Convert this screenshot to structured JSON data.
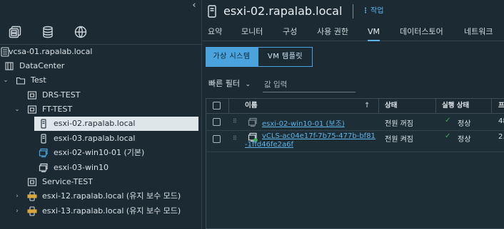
{
  "nav": {
    "collapse_icon": "chevron-left-icon",
    "icons": [
      "hosts-clusters-icon",
      "storage-icon",
      "network-icon"
    ],
    "tree": [
      {
        "label": "vcsa-01.rapalab.local",
        "icon": "vcenter-icon",
        "selected": false
      },
      {
        "label": "DataCenter",
        "icon": "datacenter-icon",
        "selected": false
      },
      {
        "label": "Test",
        "icon": "folder-icon",
        "selected": false
      },
      {
        "label": "DRS-TEST",
        "icon": "cluster-icon",
        "selected": false
      },
      {
        "label": "FT-TEST",
        "icon": "cluster-icon",
        "selected": false
      },
      {
        "label": "esxi-02.rapalab.local",
        "icon": "host-icon",
        "selected": true
      },
      {
        "label": "esxi-03.rapalab.local",
        "icon": "host-icon",
        "selected": false
      },
      {
        "label": "esxi-02-win10-01 (기본)",
        "icon": "vm-ft-primary-icon",
        "selected": false
      },
      {
        "label": "esxi-03-win10",
        "icon": "vm-icon",
        "selected": false
      },
      {
        "label": "Service-TEST",
        "icon": "cluster-icon",
        "selected": false
      },
      {
        "label": "esxi-12.rapalab.local (유지 보수 모드)",
        "icon": "host-maintenance-icon",
        "selected": false
      },
      {
        "label": "esxi-13.rapalab.local (유지 보수 모드)",
        "icon": "host-maintenance-icon",
        "selected": false
      }
    ]
  },
  "header": {
    "title": "esxi-02.rapalab.local",
    "actions_label": "작업"
  },
  "tabs": [
    "요약",
    "모니터",
    "구성",
    "사용 권한",
    "VM",
    "데이터스토어",
    "네트워크"
  ],
  "active_tab": "VM",
  "subtabs": [
    "가상 시스템",
    "VM 템플릿"
  ],
  "filter": {
    "quick_label": "빠른 필터",
    "placeholder": "값 입력"
  },
  "grid": {
    "columns": [
      "이름",
      "상태",
      "실행 상태",
      "프"
    ],
    "rows": [
      {
        "name": "esxi-02-win10-01 (보조)",
        "state": "전원 꺼짐",
        "status": "정상",
        "extra": "48"
      },
      {
        "name_line1": "vCLS-ac04e17f-7b75-477b-bf81",
        "name_line2": "-1ffd46fe2a6f",
        "state": "전원 켜짐",
        "status": "정상",
        "extra": "2."
      }
    ]
  },
  "colors": {
    "background": "#1b2a33",
    "accent": "#4aa3dc",
    "link": "#5fb4e8",
    "ok": "#3fae55"
  }
}
